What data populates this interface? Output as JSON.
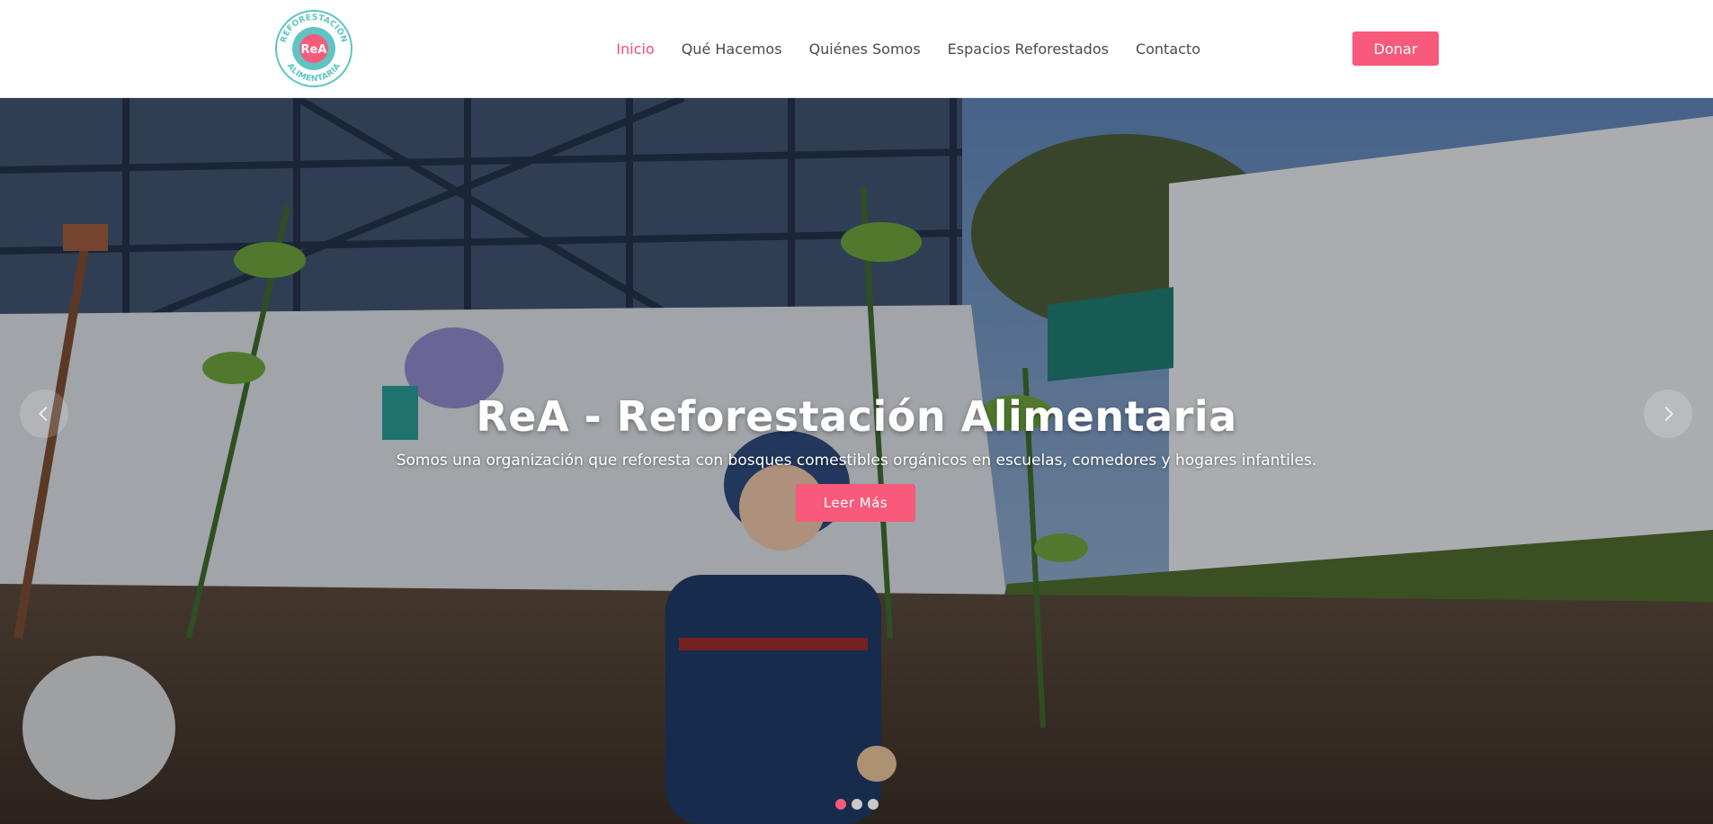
{
  "logo": {
    "ring_top_text": "REFORESTACIÓN",
    "ring_bottom_text": "ALIMENTARIA",
    "center_text": "ReA",
    "colors": {
      "ring": "#5fc4c4",
      "center": "#f75a7a",
      "text": "#5fc4c4"
    }
  },
  "nav": {
    "items": [
      {
        "label": "Inicio",
        "active": true
      },
      {
        "label": "Qué Hacemos",
        "active": false
      },
      {
        "label": "Quiénes Somos",
        "active": false
      },
      {
        "label": "Espacios Reforestados",
        "active": false
      },
      {
        "label": "Contacto",
        "active": false
      }
    ],
    "donate_label": "Donar"
  },
  "hero": {
    "title": "ReA - Reforestación Alimentaria",
    "subtitle": "Somos una organización que reforesta con bosques comestibles orgánicos en escuelas, comedores y hogares infantiles.",
    "cta_label": "Leer Más",
    "prev_icon": "chevron-left-icon",
    "next_icon": "chevron-right-icon",
    "slides_count": 3,
    "active_slide": 1
  },
  "colors": {
    "accent": "#f75a7a",
    "nav_active": "#f0506e",
    "nav_text": "#4a4a4a"
  }
}
